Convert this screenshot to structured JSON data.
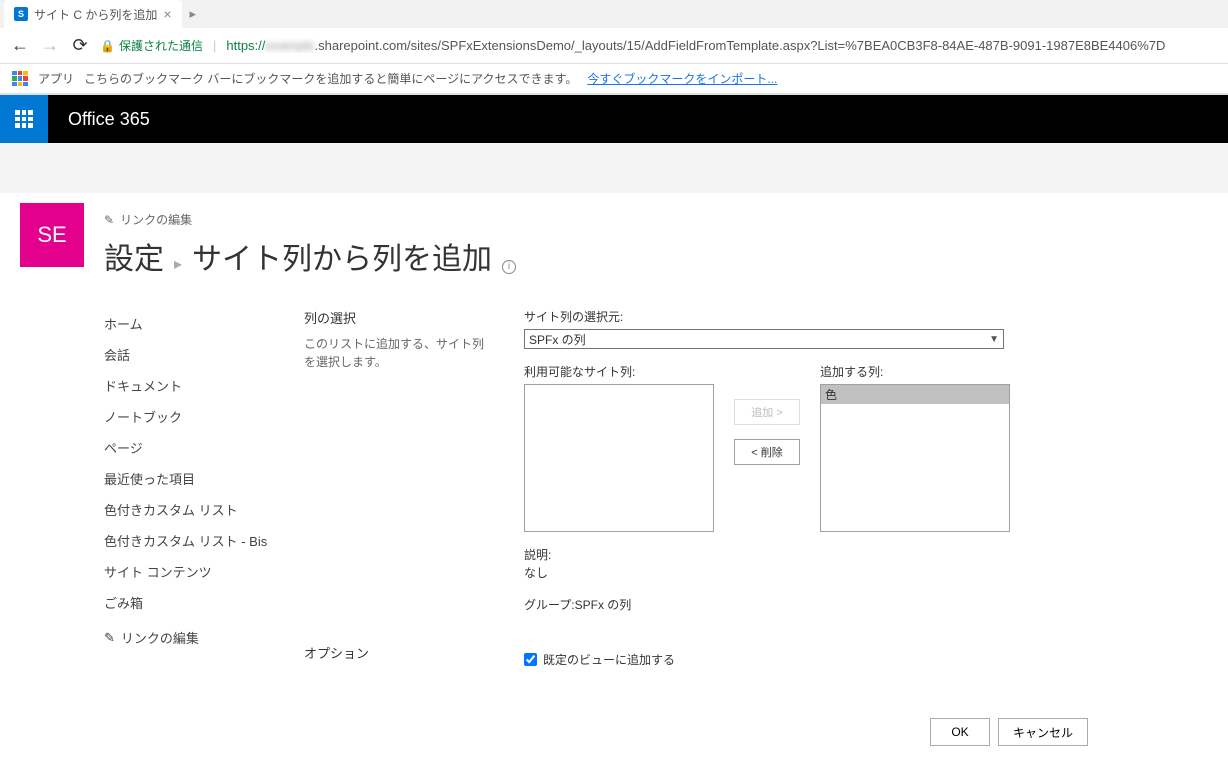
{
  "browser": {
    "tab_title": "サイト C から列を追加",
    "secure_label": "保護された通信",
    "url_proto": "https://",
    "url_blur": "example",
    "url_rest": ".sharepoint.com/sites/SPFxExtensionsDemo/_layouts/15/AddFieldFromTemplate.aspx?List=%7BEA0CB3F8-84AE-487B-9091-1987E8BE4406%7D",
    "apps_label": "アプリ",
    "bookmark_msg": "こちらのブックマーク バーにブックマークを追加すると簡単にページにアクセスできます。",
    "import_link": "今すぐブックマークをインポート..."
  },
  "suite": {
    "brand": "Office 365"
  },
  "site": {
    "tile_text": "SE",
    "edit_links": "リンクの編集",
    "breadcrumb_root": "設定",
    "page_title": "サイト列から列を追加"
  },
  "nav": {
    "items": [
      "ホーム",
      "会話",
      "ドキュメント",
      "ノートブック",
      "ページ",
      "最近使った項目",
      "色付きカスタム リスト",
      "色付きカスタム リスト - Bis",
      "サイト コンテンツ",
      "ごみ箱"
    ],
    "edit_link": "リンクの編集"
  },
  "form": {
    "section1_title": "列の選択",
    "section1_desc": "このリストに追加する、サイト列を選択します。",
    "group_label": "サイト列の選択元:",
    "group_value": "SPFx の列",
    "available_label": "利用可能なサイト列:",
    "toadd_label": "追加する列:",
    "toadd_items": [
      {
        "label": "色",
        "selected": true
      }
    ],
    "add_btn": "追加 >",
    "remove_btn": "< 削除",
    "desc_label": "説明:",
    "desc_value": "なし",
    "group_info_label": "グループ:",
    "group_info_value": "SPFx の列",
    "options_title": "オプション",
    "options_checkbox": "既定のビューに追加する",
    "ok_btn": "OK",
    "cancel_btn": "キャンセル"
  }
}
